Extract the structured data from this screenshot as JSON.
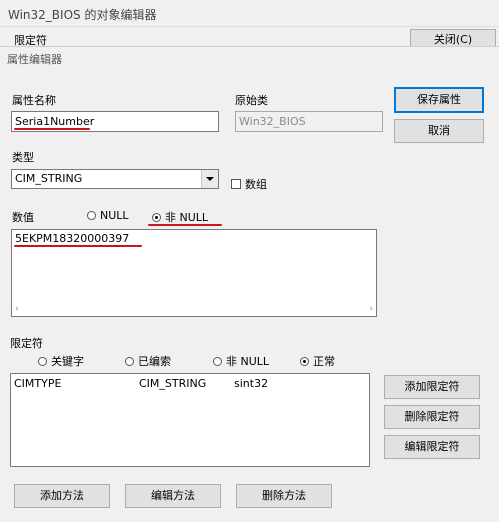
{
  "background_window": {
    "title": "Win32_BIOS 的对象编辑器",
    "qualifier_label": "限定符",
    "close_button": "关闭(C)"
  },
  "dialog": {
    "title": "属性编辑器",
    "property_name_label": "属性名称",
    "property_name_value": "Seria1Number",
    "origin_class_label": "原始类",
    "origin_class_value": "Win32_BIOS",
    "save_button": "保存属性",
    "cancel_button": "取消",
    "type_label": "类型",
    "type_value": "CIM_STRING",
    "array_label": "数组",
    "value_label": "数值",
    "null_label": "NULL",
    "not_null_label": "非 NULL",
    "value_text": "5EKPM18320000397",
    "qualifiers_label": "限定符",
    "filters": [
      "关键字",
      "已编索",
      "非 NULL",
      "正常"
    ],
    "qualifier_row": {
      "name": "CIMTYPE",
      "type": "CIM_STRING",
      "value": "sint32"
    },
    "add_qualifier": "添加限定符",
    "delete_qualifier": "删除限定符",
    "edit_qualifier": "编辑限定符",
    "add_method": "添加方法",
    "edit_method": "编辑方法",
    "delete_method": "删除方法"
  },
  "colors": {
    "annotation_red": "#c8151b",
    "focus_blue": "#0078d7"
  },
  "icons": [
    "scroll-left-icon",
    "scroll-right-icon",
    "dropdown-arrow-icon"
  ]
}
